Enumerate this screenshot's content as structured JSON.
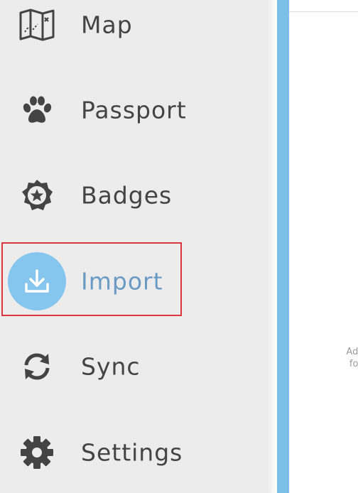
{
  "sidebar": {
    "items": [
      {
        "label": "Map",
        "icon": "map-icon",
        "active": false
      },
      {
        "label": "Passport",
        "icon": "paw-icon",
        "active": false
      },
      {
        "label": "Badges",
        "icon": "badge-icon",
        "active": false
      },
      {
        "label": "Import",
        "icon": "download-icon",
        "active": true
      },
      {
        "label": "Sync",
        "icon": "sync-icon",
        "active": false
      },
      {
        "label": "Settings",
        "icon": "gear-icon",
        "active": false
      }
    ]
  },
  "main": {
    "hint_line1": "Add",
    "hint_line2": "fol"
  },
  "colors": {
    "sidebar_bg": "#ececec",
    "text": "#444444",
    "active_text": "#6b9bc4",
    "active_circle": "#86c5ee",
    "accent_bar": "#7cc0e7",
    "highlight_border": "#d9363e"
  }
}
